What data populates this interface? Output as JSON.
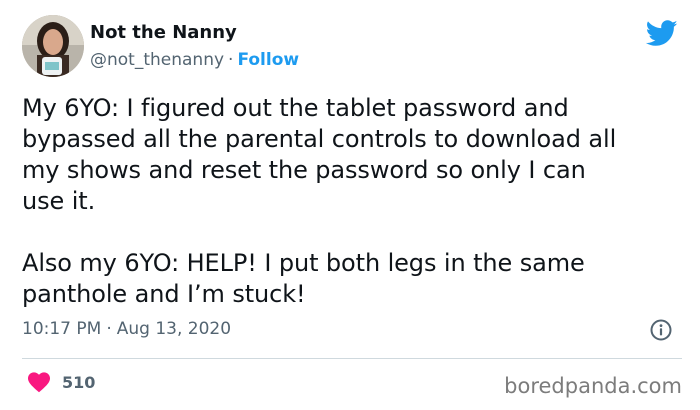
{
  "user": {
    "display_name": "Not the Nanny",
    "handle": "@not_thenanny",
    "separator": "·",
    "follow_label": "Follow"
  },
  "tweet": {
    "text": "My 6YO: I figured out the tablet password and\nbypassed all the parental controls to download all\nmy shows and reset the password so only I can\nuse it.\n\nAlso my 6YO: HELP! I put both legs in the same\npanthole and I’m stuck!",
    "time": "10:17 PM",
    "separator": "·",
    "date": "Aug 13, 2020"
  },
  "engagement": {
    "likes": "510"
  },
  "watermark": "boredpanda.com",
  "colors": {
    "accent": "#1d9bf0",
    "heart": "#f91880",
    "text": "#0f1419",
    "muted": "#536471"
  },
  "icons": {
    "brand": "twitter-bird-icon",
    "info": "info-icon",
    "like": "heart-icon"
  }
}
